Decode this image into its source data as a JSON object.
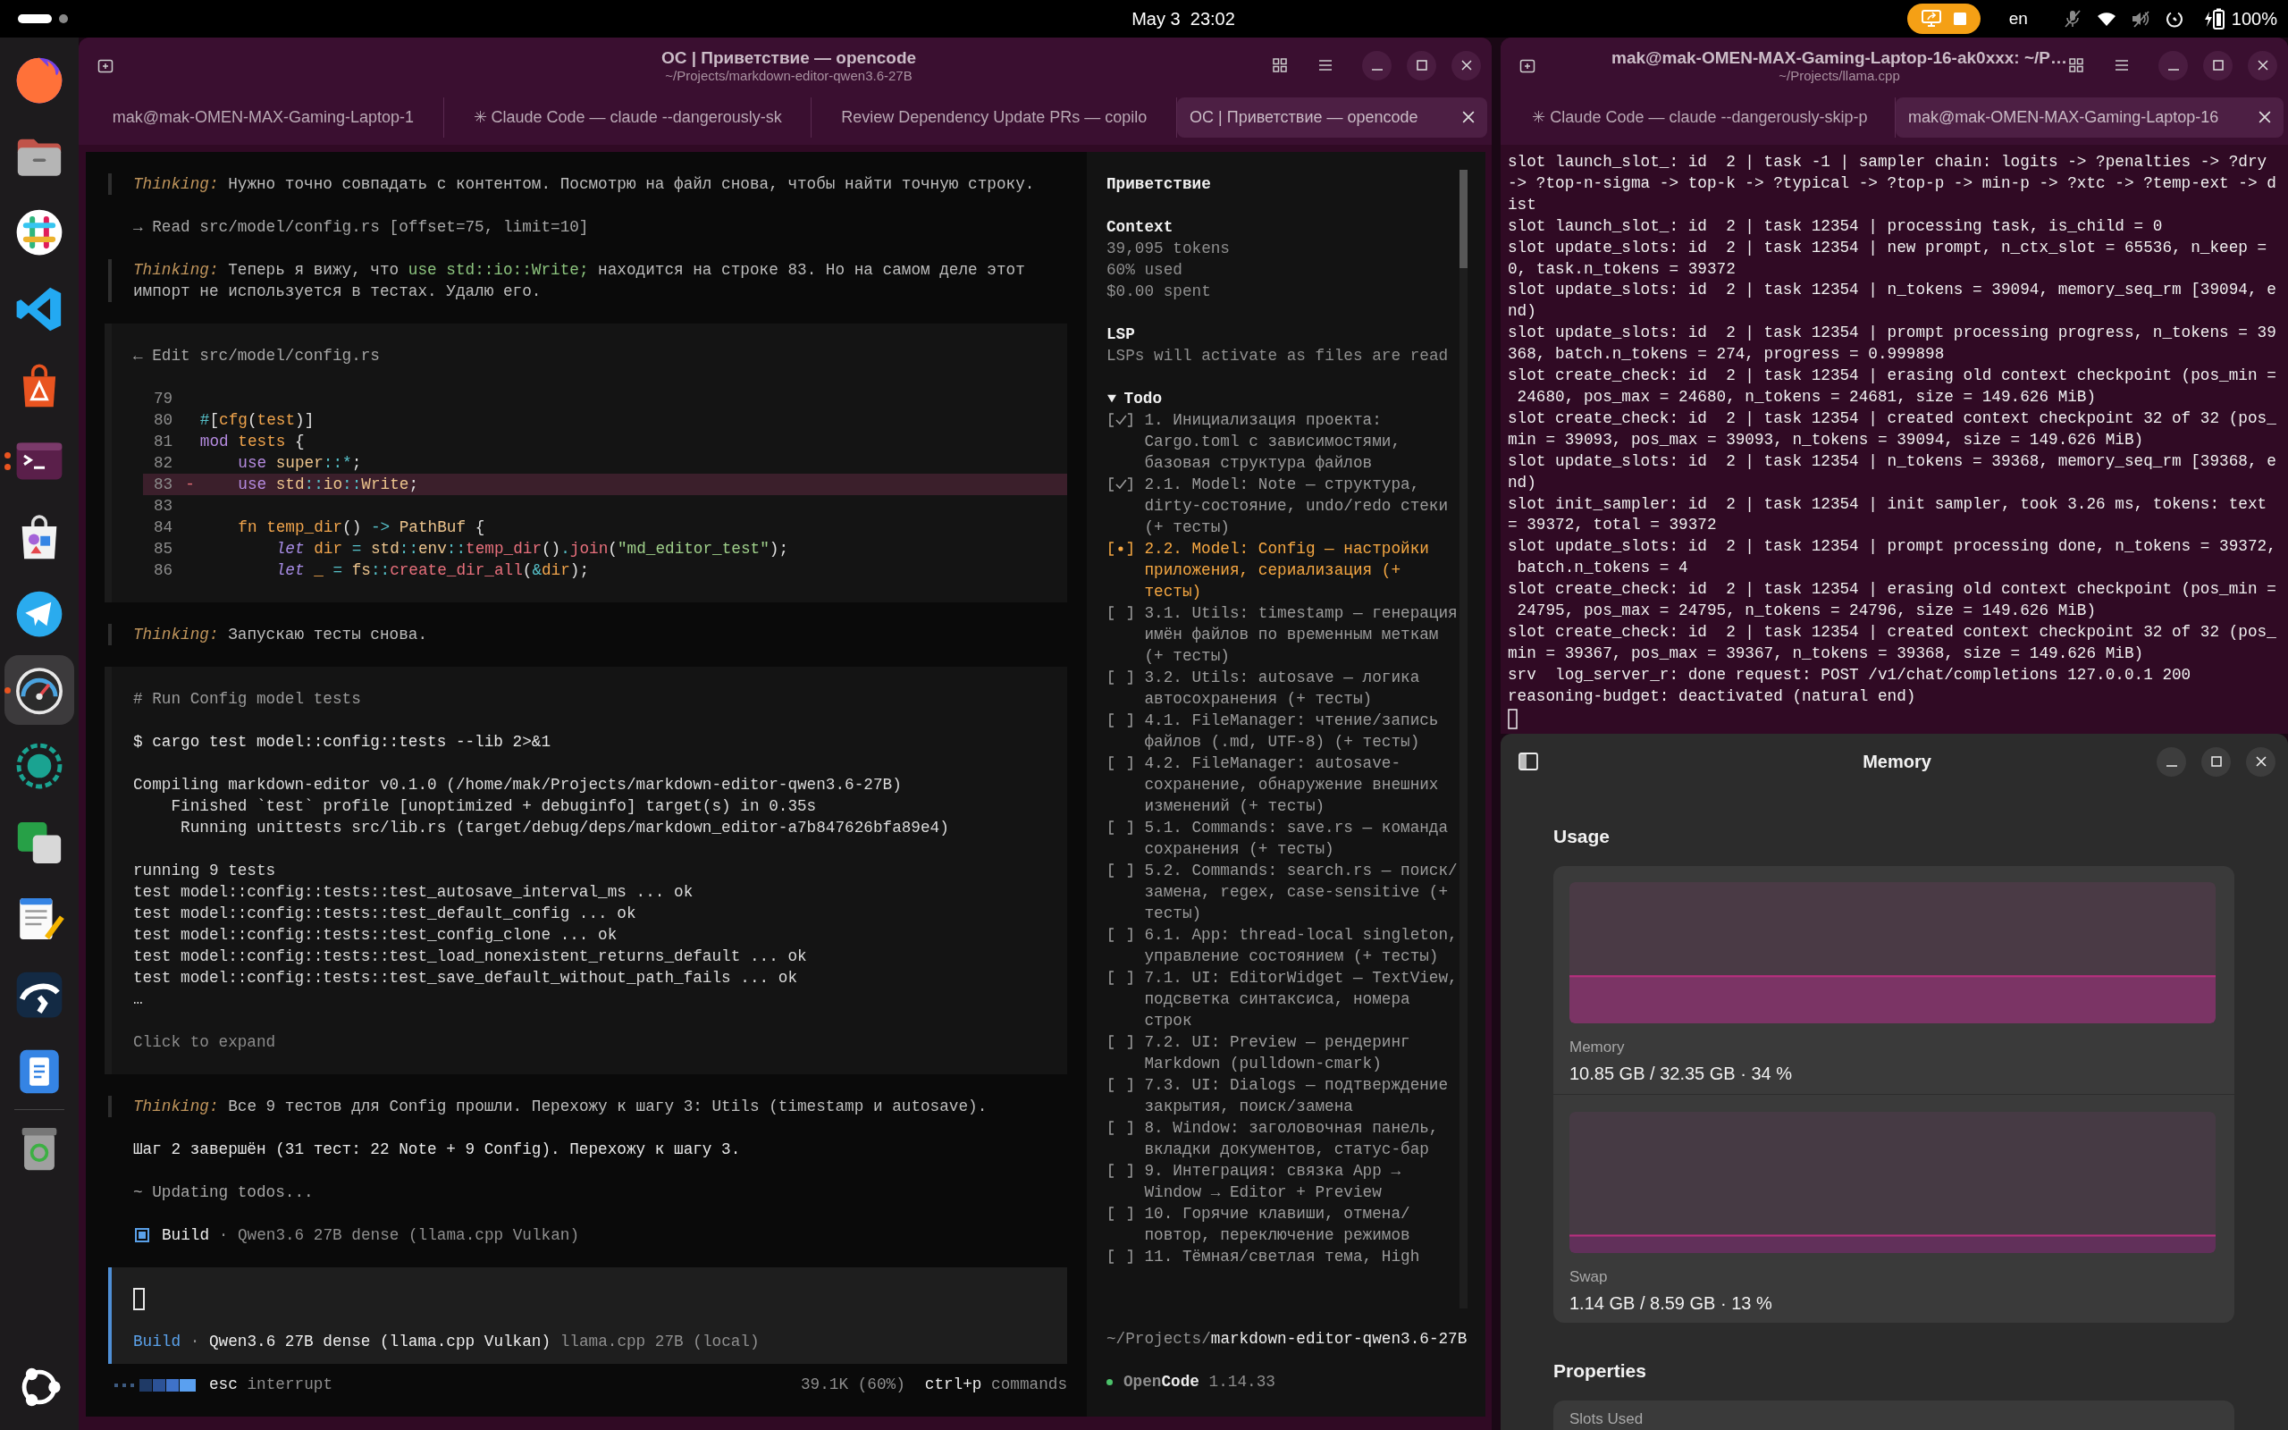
{
  "top_bar": {
    "workspaces": [
      {
        "selected": true
      },
      {
        "selected": false
      }
    ],
    "clock": "May 3  23:02",
    "screen_sharing": true,
    "keyboard_layout": "en",
    "microphone_muted": true,
    "volume_muted": true,
    "battery": "100%"
  },
  "dock": {
    "items": [
      {
        "kind": "browser",
        "running": false,
        "multiple_windows": false,
        "focused": false
      },
      {
        "kind": "files",
        "running": false,
        "multiple_windows": false,
        "focused": false
      },
      {
        "kind": "chat",
        "running": false,
        "multiple_windows": false,
        "focused": false
      },
      {
        "kind": "editor",
        "running": false,
        "multiple_windows": false,
        "focused": false
      },
      {
        "kind": "store",
        "running": false,
        "multiple_windows": false,
        "focused": false
      },
      {
        "kind": "terminal",
        "running": true,
        "multiple_windows": true,
        "focused": false
      },
      {
        "kind": "software",
        "running": false,
        "multiple_windows": false,
        "focused": false
      },
      {
        "kind": "messenger",
        "running": false,
        "multiple_windows": false,
        "focused": false
      },
      {
        "kind": "monitor",
        "running": true,
        "multiple_windows": false,
        "focused": true
      },
      {
        "kind": "tracker",
        "running": false,
        "multiple_windows": false,
        "focused": false
      },
      {
        "kind": "dictionary",
        "running": false,
        "multiple_windows": false,
        "focused": false
      },
      {
        "kind": "notepad",
        "running": false,
        "multiple_windows": false,
        "focused": false
      },
      {
        "kind": "remote",
        "running": false,
        "multiple_windows": false,
        "focused": false
      },
      {
        "kind": "notes",
        "running": false,
        "multiple_windows": false,
        "focused": false
      },
      {
        "kind": "trash",
        "running": false,
        "multiple_windows": false,
        "focused": false
      }
    ]
  },
  "left_terminal": {
    "title": "OC | Приветствие — opencode",
    "subtitle": "~/Projects/markdown-editor-qwen3.6-27B",
    "tabs": [
      {
        "label": "mak@mak-OMEN-MAX-Gaming-Laptop-1",
        "selected": false
      },
      {
        "label": "✳ Claude Code — claude --dangerously-sk",
        "selected": false
      },
      {
        "label": "Review Dependency Update PRs — copilo",
        "selected": false
      },
      {
        "label": "OC | Приветствие — opencode",
        "selected": true
      }
    ],
    "transcript": [
      {
        "kind": "thinking",
        "label": "Thinking:",
        "segments": [
          {
            "kind": "text",
            "text": "Нужно точно совпадать с контентом. Посмотрю на файл снова, чтобы найти точную строку."
          }
        ]
      },
      {
        "kind": "tool",
        "text": "→ Read src/model/config.rs [offset=75, limit=10]"
      },
      {
        "kind": "thinking",
        "label": "Thinking:",
        "segments": [
          {
            "kind": "text",
            "text": "Теперь я вижу, что "
          },
          {
            "kind": "code",
            "text": "use std::io::Write;"
          },
          {
            "kind": "text",
            "text": " находится на строке 83. Но на самом деле этот импорт не используется в тестах. Удалю его."
          }
        ]
      },
      {
        "kind": "edit",
        "header": "← Edit src/model/config.rs",
        "lines": [
          {
            "number": "79",
            "removed": false
          },
          {
            "number": "80",
            "removed": false,
            "tokens": [
              {
                "kind": "operator",
                "text": "#"
              },
              {
                "kind": "punct",
                "text": "["
              },
              {
                "kind": "name",
                "text": "cfg"
              },
              {
                "kind": "punct",
                "text": "("
              },
              {
                "kind": "name",
                "text": "test"
              },
              {
                "kind": "punct",
                "text": ")]"
              }
            ]
          },
          {
            "number": "81",
            "removed": false,
            "tokens": [
              {
                "kind": "keyword",
                "text": "mod"
              },
              {
                "kind": "name",
                "text": " tests"
              },
              {
                "kind": "punct",
                "text": " {"
              }
            ]
          },
          {
            "number": "82",
            "removed": false,
            "tokens": [
              {
                "kind": "keyword",
                "text": "    use"
              },
              {
                "kind": "type",
                "text": " super"
              },
              {
                "kind": "operator",
                "text": "::*"
              },
              {
                "kind": "punct",
                "text": ";"
              }
            ]
          },
          {
            "number": "83",
            "marker": "-",
            "removed": true,
            "tokens": [
              {
                "kind": "keyword",
                "text": "    use"
              },
              {
                "kind": "type",
                "text": " std"
              },
              {
                "kind": "operator",
                "text": "::"
              },
              {
                "kind": "type",
                "text": "io"
              },
              {
                "kind": "operator",
                "text": "::"
              },
              {
                "kind": "type",
                "text": "Write"
              },
              {
                "kind": "punct",
                "text": ";"
              }
            ]
          },
          {
            "number": "83",
            "removed": false
          },
          {
            "number": "84",
            "removed": false,
            "tokens": [
              {
                "kind": "name",
                "text": "    fn temp_dir"
              },
              {
                "kind": "punct",
                "text": "()"
              },
              {
                "kind": "operator",
                "text": " ->"
              },
              {
                "kind": "type",
                "text": " PathBuf"
              },
              {
                "kind": "punct",
                "text": " {"
              }
            ]
          },
          {
            "number": "85",
            "removed": false,
            "tokens": [
              {
                "kind": "keyword_italic",
                "text": "        let"
              },
              {
                "kind": "name",
                "text": " dir"
              },
              {
                "kind": "operator",
                "text": " ="
              },
              {
                "kind": "type",
                "text": " std"
              },
              {
                "kind": "operator",
                "text": "::"
              },
              {
                "kind": "type",
                "text": "env"
              },
              {
                "kind": "operator",
                "text": "::"
              },
              {
                "kind": "call",
                "text": "temp_dir"
              },
              {
                "kind": "punct",
                "text": "()"
              },
              {
                "kind": "operator",
                "text": "."
              },
              {
                "kind": "call",
                "text": "join"
              },
              {
                "kind": "punct",
                "text": "("
              },
              {
                "kind": "string",
                "text": "\"md_editor_test\""
              },
              {
                "kind": "punct",
                "text": ");"
              }
            ]
          },
          {
            "number": "86",
            "removed": false,
            "tokens": [
              {
                "kind": "keyword_italic",
                "text": "        let"
              },
              {
                "kind": "name",
                "text": " _"
              },
              {
                "kind": "operator",
                "text": " ="
              },
              {
                "kind": "type",
                "text": " fs"
              },
              {
                "kind": "operator",
                "text": "::"
              },
              {
                "kind": "call",
                "text": "create_dir_all"
              },
              {
                "kind": "punct",
                "text": "("
              },
              {
                "kind": "operator",
                "text": "&"
              },
              {
                "kind": "name",
                "text": "dir"
              },
              {
                "kind": "punct",
                "text": ");"
              }
            ]
          }
        ]
      },
      {
        "kind": "thinking",
        "label": "Thinking:",
        "segments": [
          {
            "kind": "text",
            "text": "Запускаю тесты снова."
          }
        ]
      },
      {
        "kind": "bash",
        "comment": "# Run Config model tests",
        "command": "$ cargo test model::config::tests --lib 2>&1",
        "output_groups": [
          [
            "Compiling markdown-editor v0.1.0 (/home/mak/Projects/markdown-editor-qwen3.6-27B)",
            "    Finished `test` profile [unoptimized + debuginfo] target(s) in 0.35s",
            "     Running unittests src/lib.rs (target/debug/deps/markdown_editor-a7b847626bfa89e4)"
          ],
          [
            "running 9 tests",
            "test model::config::tests::test_autosave_interval_ms ... ok",
            "test model::config::tests::test_default_config ... ok",
            "test model::config::tests::test_config_clone ... ok",
            "test model::config::tests::test_load_nonexistent_returns_default ... ok",
            "test model::config::tests::test_save_default_without_path_fails ... ok",
            "…"
          ]
        ],
        "expand_hint": "Click to expand"
      },
      {
        "kind": "thinking",
        "label": "Thinking:",
        "segments": [
          {
            "kind": "text",
            "text": "Все 9 тестов для Config прошли. Перехожу к шагу 3: Utils (timestamp и autosave)."
          }
        ]
      },
      {
        "kind": "message",
        "text": "Шаг 2 завершён (31 тест: 22 Note + 9 Config). Перехожу к шагу 3."
      },
      {
        "kind": "tool",
        "text": "~ Updating todos..."
      },
      {
        "kind": "agent",
        "agent": "Build",
        "detail": "· Qwen3.6 27B dense (llama.cpp Vulkan)"
      }
    ],
    "prompt": {
      "agent": "Build",
      "separator": "·",
      "model": "Qwen3.6 27B dense (llama.cpp Vulkan)",
      "provider": "llama.cpp 27B (local)"
    },
    "status_bar": {
      "key": "esc",
      "action": "interrupt",
      "context": "39.1K (60%)",
      "shortcut_key": "ctrl+p",
      "shortcut_action": "commands"
    },
    "sidebar": {
      "session_title": "Приветствие",
      "context": {
        "heading": "Context",
        "lines": [
          "39,095 tokens",
          "60% used",
          "$0.00 spent"
        ]
      },
      "lsp": {
        "heading": "LSP",
        "text": "LSPs will activate as files are read"
      },
      "todo": {
        "title": "Todo",
        "expanded": true,
        "items": [
          {
            "checked": true,
            "active": false,
            "text": "1. Инициализация проекта: Cargo.toml с зависимостями, базовая структура файлов"
          },
          {
            "checked": true,
            "active": false,
            "text": "2.1. Model: Note — структура, dirty-состояние, undo/redo стеки (+ тесты)"
          },
          {
            "checked": false,
            "active": true,
            "text": "2.2. Model: Config — настройки приложения, сериализация (+ тесты)"
          },
          {
            "checked": false,
            "active": false,
            "text": "3.1. Utils: timestamp — генерация имён файлов по временным меткам (+ тесты)"
          },
          {
            "checked": false,
            "active": false,
            "text": "3.2. Utils: autosave — логика автосохранения (+ тесты)"
          },
          {
            "checked": false,
            "active": false,
            "text": "4.1. FileManager: чтение/запись файлов (.md, UTF-8) (+ тесты)"
          },
          {
            "checked": false,
            "active": false,
            "text": "4.2. FileManager: autosave-сохранение, обнаружение внешних изменений (+ тесты)"
          },
          {
            "checked": false,
            "active": false,
            "text": "5.1. Commands: save.rs — команда сохранения (+ тесты)"
          },
          {
            "checked": false,
            "active": false,
            "text": "5.2. Commands: search.rs — поиск/замена, regex, case-sensitive (+ тесты)"
          },
          {
            "checked": false,
            "active": false,
            "text": "6.1. App: thread-local singleton, управление состоянием (+ тесты)"
          },
          {
            "checked": false,
            "active": false,
            "text": "7.1. UI: EditorWidget — TextView, подсветка синтаксиса, номера строк"
          },
          {
            "checked": false,
            "active": false,
            "text": "7.2. UI: Preview — рендеринг Markdown (pulldown-cmark)"
          },
          {
            "checked": false,
            "active": false,
            "text": "7.3. UI: Dialogs — подтверждение закрытия, поиск/замена"
          },
          {
            "checked": false,
            "active": false,
            "text": "8. Window: заголовочная панель, вкладки документов, статус-бар"
          },
          {
            "checked": false,
            "active": false,
            "text": "9. Интеграция: связка App → Window → Editor + Preview"
          },
          {
            "checked": false,
            "active": false,
            "text": "10. Горячие клавиши, отмена/повтор, переключение режимов"
          },
          {
            "checked": false,
            "active": false,
            "text": "11. Тёмная/светлая тема, High"
          }
        ]
      },
      "path": {
        "dir": "~/Projects/",
        "name": "markdown-editor-qwen3.6-27B"
      },
      "app": {
        "connected": true,
        "prefix": "Open",
        "name": "Code",
        "version": "1.14.33"
      }
    }
  },
  "right_terminal": {
    "title": "mak@mak-OMEN-MAX-Gaming-Laptop-16-ak0xxx: ~/P…",
    "subtitle": "~/Projects/llama.cpp",
    "tabs": [
      {
        "label": "✳ Claude Code — claude --dangerously-skip-p",
        "selected": false
      },
      {
        "label": "mak@mak-OMEN-MAX-Gaming-Laptop-16",
        "selected": true
      }
    ],
    "log_lines": [
      "slot launch_slot_: id  2 | task -1 | sampler chain: logits -> ?penalties -> ?dry -> ?top-n-sigma -> top-k -> ?typical -> ?top-p -> min-p -> ?xtc -> ?temp-ext -> dist",
      "slot launch_slot_: id  2 | task 12354 | processing task, is_child = 0",
      "slot update_slots: id  2 | task 12354 | new prompt, n_ctx_slot = 65536, n_keep = 0, task.n_tokens = 39372",
      "slot update_slots: id  2 | task 12354 | n_tokens = 39094, memory_seq_rm [39094, end)",
      "slot update_slots: id  2 | task 12354 | prompt processing progress, n_tokens = 39368, batch.n_tokens = 274, progress = 0.999898",
      "slot create_check: id  2 | task 12354 | erasing old context checkpoint (pos_min = 24680, pos_max = 24680, n_tokens = 24681, size = 149.626 MiB)",
      "slot create_check: id  2 | task 12354 | created context checkpoint 32 of 32 (pos_min = 39093, pos_max = 39093, n_tokens = 39094, size = 149.626 MiB)",
      "slot update_slots: id  2 | task 12354 | n_tokens = 39368, memory_seq_rm [39368, end)",
      "slot init_sampler: id  2 | task 12354 | init sampler, took 3.26 ms, tokens: text = 39372, total = 39372",
      "slot update_slots: id  2 | task 12354 | prompt processing done, n_tokens = 39372, batch.n_tokens = 4",
      "slot create_check: id  2 | task 12354 | erasing old context checkpoint (pos_min = 24795, pos_max = 24795, n_tokens = 24796, size = 149.626 MiB)",
      "slot create_check: id  2 | task 12354 | created context checkpoint 32 of 32 (pos_min = 39367, pos_max = 39367, n_tokens = 39368, size = 149.626 MiB)",
      "srv  log_server_r: done request: POST /v1/chat/completions 127.0.0.1 200",
      "reasoning-budget: deactivated (natural end)"
    ]
  },
  "memory_window": {
    "title": "Memory",
    "usage_heading": "Usage",
    "meters": [
      {
        "label": "Memory",
        "value": "10.85 GB / 32.35 GB · 34 %",
        "color": "#7b3465"
      },
      {
        "label": "Swap",
        "value": "1.14 GB / 8.59 GB · 13 %",
        "color": "#61305a"
      }
    ],
    "properties_heading": "Properties",
    "properties": [
      {
        "label": "Slots Used"
      }
    ]
  }
}
